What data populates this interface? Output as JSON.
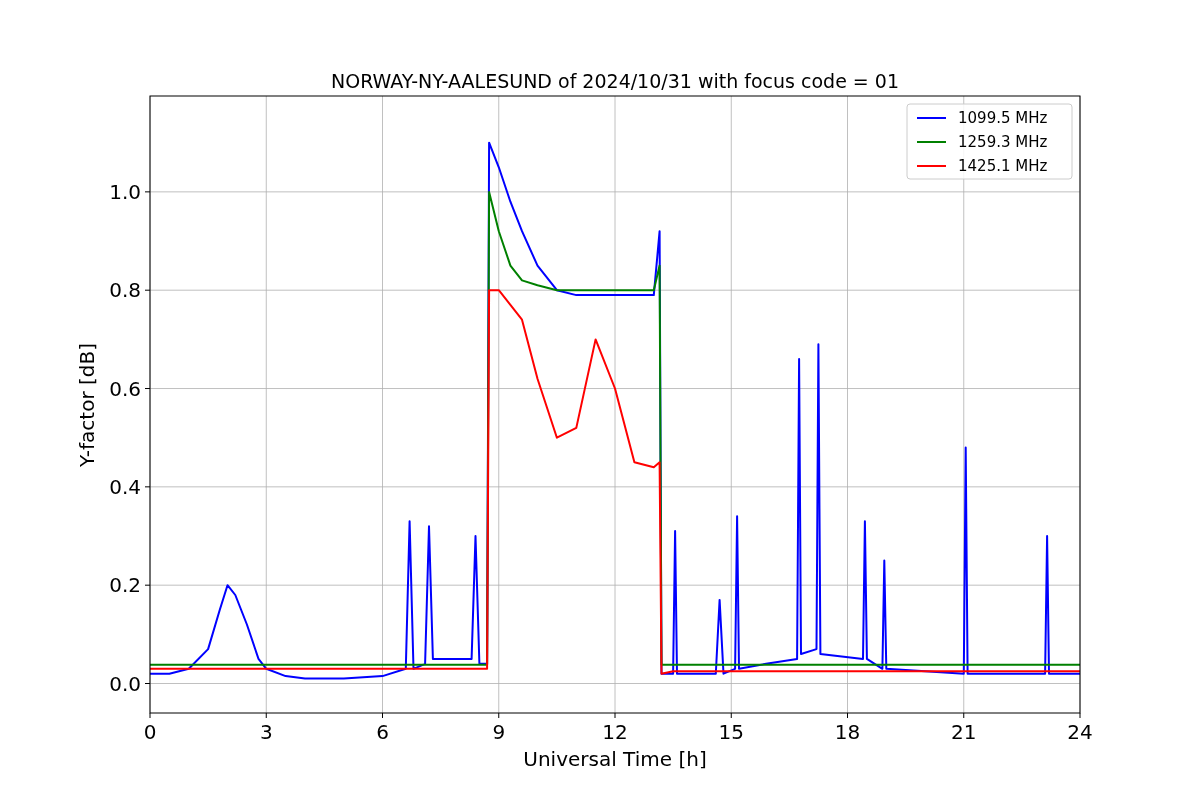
{
  "chart_data": {
    "type": "line",
    "grid": true,
    "legend": "upper right",
    "title": "NORWAY-NY-AALESUND of 2024/10/31 with focus code = 01",
    "xlabel": "Universal Time [h]",
    "ylabel": "Y-factor [dB]",
    "xlim": [
      0,
      24
    ],
    "ylim": [
      -0.06,
      1.195
    ],
    "xticks": [
      0,
      3,
      6,
      9,
      12,
      15,
      18,
      21,
      24
    ],
    "yticks": [
      {
        "value": 0,
        "label": "0.0"
      },
      {
        "value": 0.2,
        "label": "0.2"
      },
      {
        "value": 0.4,
        "label": "0.4"
      },
      {
        "value": 0.6,
        "label": "0.6"
      },
      {
        "value": 0.8,
        "label": "0.8"
      },
      {
        "value": 1,
        "label": "1.0"
      }
    ],
    "x": [
      0,
      0.5,
      1,
      1.5,
      1.8,
      2,
      2.2,
      2.5,
      2.8,
      3,
      3.5,
      4,
      5,
      6,
      6.6,
      6.7,
      6.8,
      7.1,
      7.2,
      7.3,
      8,
      8.3,
      8.4,
      8.5,
      8.7,
      8.75,
      9,
      9.3,
      9.6,
      10,
      10.5,
      11,
      11.5,
      12,
      12.5,
      13,
      13.15,
      13.2,
      13.5,
      13.55,
      13.6,
      14.6,
      14.7,
      14.8,
      15.1,
      15.15,
      15.2,
      15.9,
      16.7,
      16.75,
      16.8,
      17.2,
      17.25,
      17.3,
      18.4,
      18.45,
      18.5,
      18.9,
      18.95,
      19,
      21,
      21.05,
      21.1,
      22.7,
      23.1,
      23.15,
      23.2,
      24
    ],
    "series": [
      {
        "name": "1099.5 MHz",
        "color": "#0000ff",
        "values": [
          0.02,
          0.02,
          0.03,
          0.07,
          0.15,
          0.2,
          0.18,
          0.12,
          0.05,
          0.03,
          0.015,
          0.01,
          0.01,
          0.015,
          0.03,
          0.33,
          0.03,
          0.04,
          0.32,
          0.05,
          0.05,
          0.05,
          0.3,
          0.04,
          0.04,
          1.1,
          1.05,
          0.98,
          0.92,
          0.85,
          0.8,
          0.79,
          0.79,
          0.79,
          0.79,
          0.79,
          0.92,
          0.02,
          0.02,
          0.31,
          0.02,
          0.02,
          0.17,
          0.02,
          0.03,
          0.34,
          0.03,
          0.04,
          0.05,
          0.66,
          0.06,
          0.07,
          0.69,
          0.06,
          0.05,
          0.33,
          0.05,
          0.03,
          0.25,
          0.03,
          0.02,
          0.48,
          0.02,
          0.02,
          0.02,
          0.3,
          0.02,
          0.02
        ]
      },
      {
        "name": "1259.3 MHz",
        "color": "#008000",
        "values": [
          0.038,
          0.038,
          0.038,
          0.038,
          0.038,
          0.038,
          0.038,
          0.038,
          0.038,
          0.038,
          0.038,
          0.038,
          0.038,
          0.038,
          0.038,
          0.038,
          0.038,
          0.038,
          0.038,
          0.038,
          0.038,
          0.038,
          0.038,
          0.038,
          0.038,
          1.0,
          0.92,
          0.85,
          0.82,
          0.81,
          0.8,
          0.8,
          0.8,
          0.8,
          0.8,
          0.8,
          0.85,
          0.038,
          0.038,
          0.038,
          0.038,
          0.038,
          0.038,
          0.038,
          0.038,
          0.038,
          0.038,
          0.038,
          0.038,
          0.038,
          0.038,
          0.038,
          0.038,
          0.038,
          0.038,
          0.038,
          0.038,
          0.038,
          0.038,
          0.038,
          0.038,
          0.038,
          0.038,
          0.038,
          0.038,
          0.038,
          0.038,
          0.038
        ]
      },
      {
        "name": "1425.1 MHz",
        "color": "#ff0000",
        "values": [
          0.03,
          0.03,
          0.03,
          0.03,
          0.03,
          0.03,
          0.03,
          0.03,
          0.03,
          0.03,
          0.03,
          0.03,
          0.03,
          0.03,
          0.03,
          0.03,
          0.03,
          0.03,
          0.03,
          0.03,
          0.03,
          0.03,
          0.03,
          0.03,
          0.03,
          0.8,
          0.8,
          0.77,
          0.74,
          0.62,
          0.5,
          0.52,
          0.7,
          0.6,
          0.45,
          0.44,
          0.45,
          0.02,
          0.025,
          0.025,
          0.025,
          0.025,
          0.025,
          0.025,
          0.025,
          0.025,
          0.025,
          0.025,
          0.025,
          0.025,
          0.025,
          0.025,
          0.025,
          0.025,
          0.025,
          0.025,
          0.025,
          0.025,
          0.025,
          0.025,
          0.025,
          0.025,
          0.025,
          0.025,
          0.025,
          0.025,
          0.025,
          0.025
        ]
      }
    ]
  }
}
